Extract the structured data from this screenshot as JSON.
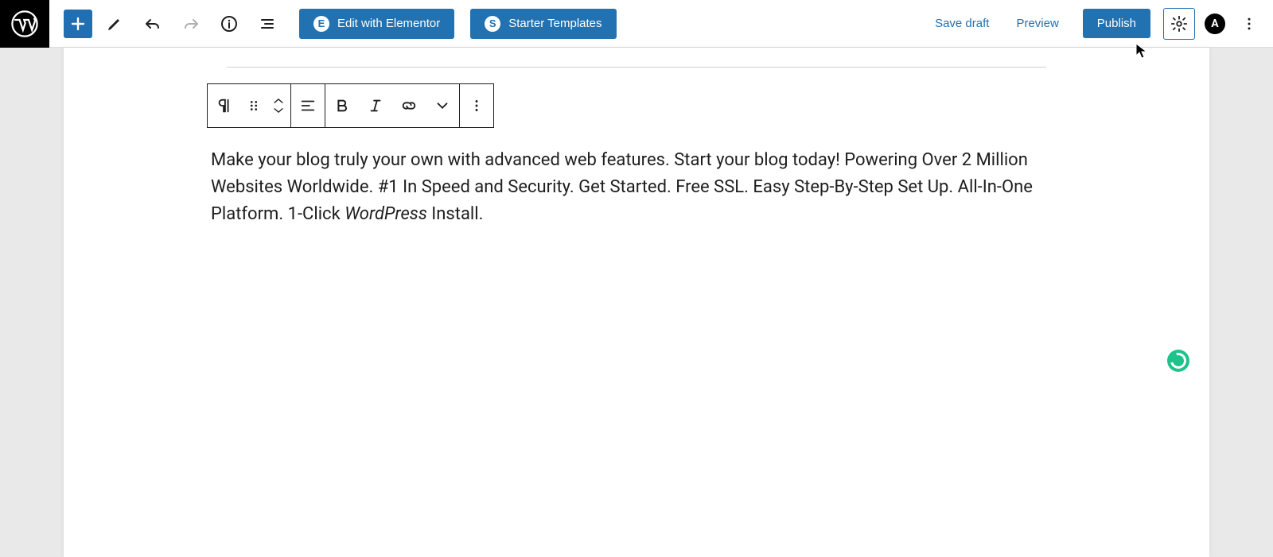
{
  "header": {
    "edit_elementor": "Edit with Elementor",
    "starter_templates": "Starter Templates",
    "save_draft": "Save draft",
    "preview": "Preview",
    "publish": "Publish"
  },
  "paragraph": {
    "pre_italic": "Make your blog truly your own with advanced web features. Start your blog today! Powering Over 2 Million Websites Worldwide. #1 In Speed and Security. Get Started. Free SSL. Easy Step-By-Step Set Up. All-In-One Platform. 1-Click ",
    "italic": "WordPress",
    "post_italic": " Install."
  },
  "icons": {
    "elementor_badge": "E",
    "starter_badge": "S",
    "astra_badge": "A"
  }
}
